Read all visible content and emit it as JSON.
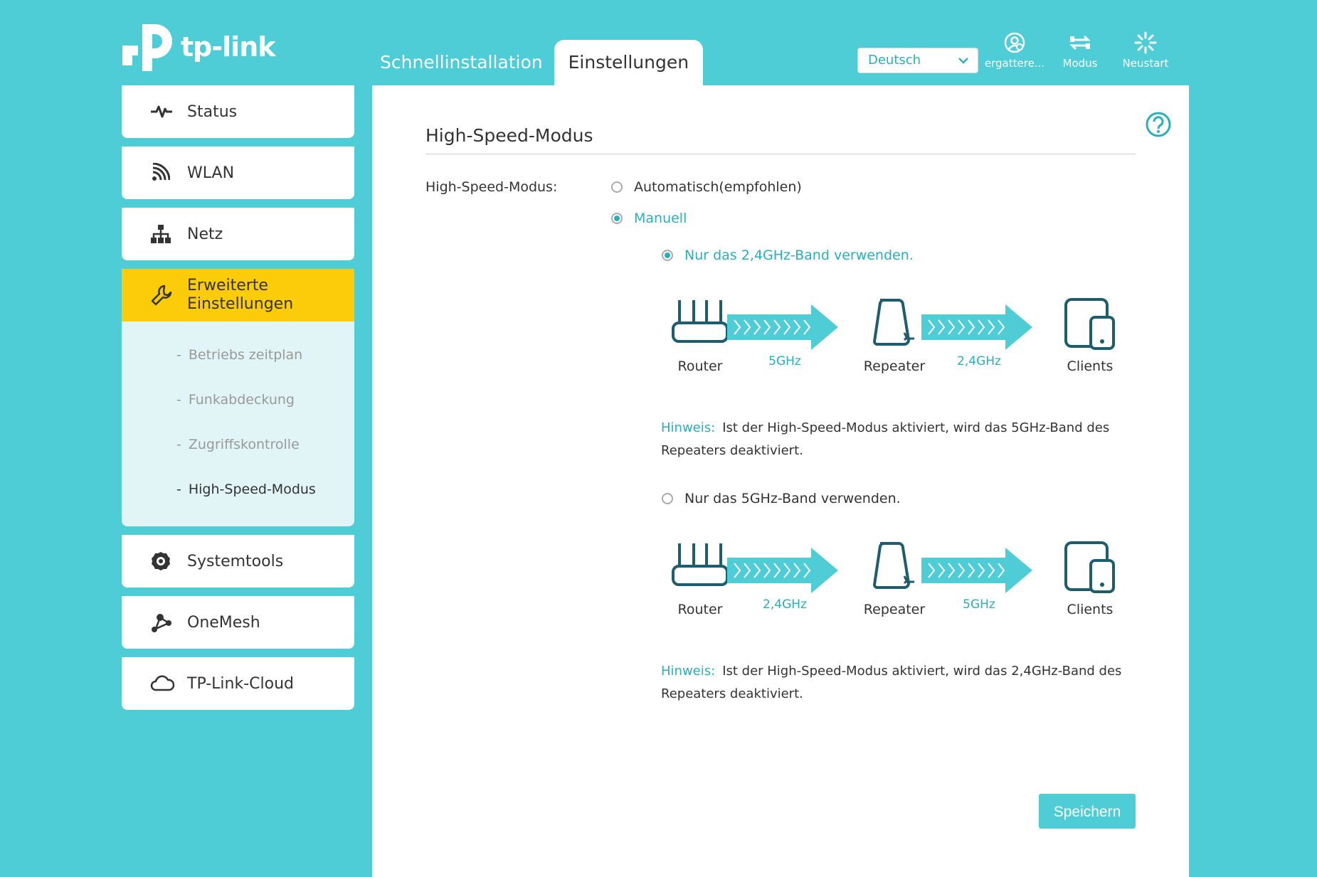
{
  "brand": {
    "name": "tp-link"
  },
  "tabs": [
    {
      "label": "Schnellinstallation",
      "active": false
    },
    {
      "label": "Einstellungen",
      "active": true
    }
  ],
  "language": {
    "selected": "Deutsch"
  },
  "top_icons": [
    {
      "label": "ergattere...",
      "icon": "user-icon"
    },
    {
      "label": "Modus",
      "icon": "mode-switch-icon"
    },
    {
      "label": "Neustart",
      "icon": "reboot-icon"
    }
  ],
  "sidebar": {
    "items": [
      {
        "label": "Status",
        "icon": "pulse-icon"
      },
      {
        "label": "WLAN",
        "icon": "wifi-icon"
      },
      {
        "label": "Netz",
        "icon": "network-icon"
      },
      {
        "label_line1": "Erweiterte",
        "label_line2": "Einstellungen",
        "icon": "wrench-icon",
        "active": true
      },
      {
        "label": "Systemtools",
        "icon": "gear-icon"
      },
      {
        "label": "OneMesh",
        "icon": "mesh-icon"
      },
      {
        "label": "TP-Link-Cloud",
        "icon": "cloud-icon"
      }
    ],
    "submenu": [
      {
        "label": "Betriebs zeitplan"
      },
      {
        "label": "Funkabdeckung"
      },
      {
        "label": "Zugriffskontrolle"
      },
      {
        "label": "High-Speed-Modus",
        "current": true
      }
    ]
  },
  "panel": {
    "title": "High-Speed-Modus",
    "field_label": "High-Speed-Modus:",
    "options": {
      "auto": "Automatisch(empfohlen)",
      "manual": "Manuell"
    },
    "band_24": {
      "label": "Nur das 2,4GHz-Band verwenden.",
      "selected": true,
      "router": "Router",
      "link1": "5GHz",
      "repeater": "Repeater",
      "link2": "2,4GHz",
      "clients": "Clients",
      "note_label": "Hinweis:",
      "note_text": "Ist der High-Speed-Modus aktiviert, wird das 5GHz-Band des Repeaters deaktiviert."
    },
    "band_5": {
      "label": "Nur das 5GHz-Band verwenden.",
      "selected": false,
      "router": "Router",
      "link1": "2,4GHz",
      "repeater": "Repeater",
      "link2": "5GHz",
      "clients": "Clients",
      "note_label": "Hinweis:",
      "note_text": "Ist der High-Speed-Modus aktiviert, wird das 2,4GHz-Band des Repeaters deaktiviert."
    },
    "save_label": "Speichern"
  },
  "colors": {
    "accent": "#4ecdd6",
    "text_accent": "#26b0bc",
    "active_nav": "#fccc0a",
    "submenu_bg": "#e1f5f7",
    "icon_dark": "#1d5d6e"
  }
}
